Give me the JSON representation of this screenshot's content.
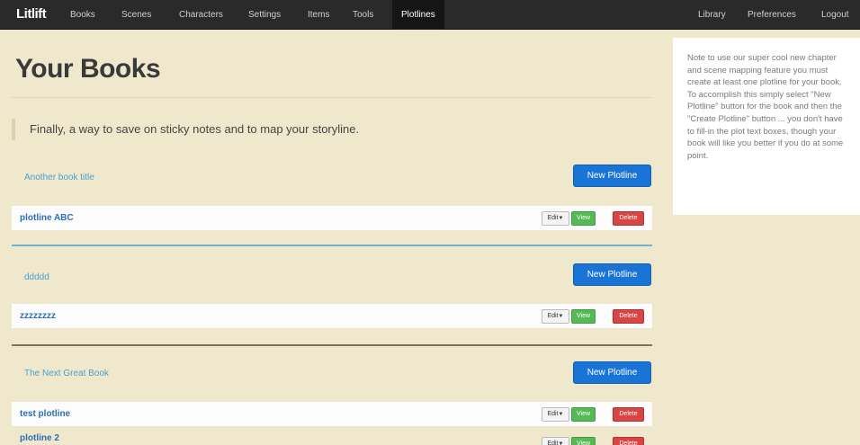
{
  "navbar": {
    "brand": "Litlift",
    "links": [
      "Books",
      "Scenes",
      "Characters",
      "Settings",
      "Items",
      "Tools",
      "Plotlines"
    ],
    "right_links": [
      "Library",
      "Preferences",
      "Logout"
    ]
  },
  "main": {
    "title": "Your Books",
    "lead": "Finally, a way to save on sticky notes and to map your storyline."
  },
  "note": "Note to use our super cool new chapter and scene mapping feature you must create at least one plotline for your book. To accomplish this simply select \"New Plotline\" button for the book and then the \"Create Plotline\" button ... you don't have to fill-in the plot text boxes, though your book will like you better if you do at some point.",
  "buttons": {
    "new_plotline": "New Plotline",
    "edit": "Edit",
    "view": "View",
    "delete": "Delete"
  },
  "books": [
    {
      "title": "Another book title",
      "plotlines": [
        "plotline ABC"
      ]
    },
    {
      "title": "ddddd",
      "plotlines": [
        "zzzzzzzz"
      ]
    },
    {
      "title": "The Next Great Book",
      "plotlines": [
        "test plotline",
        "plotline 2"
      ]
    }
  ],
  "colors": {
    "background": "#efe8cc",
    "navbar": "#2a2a2a",
    "primary": "#1a74d6",
    "success": "#56b956",
    "danger": "#d84545",
    "link": "#4a9fd0"
  }
}
